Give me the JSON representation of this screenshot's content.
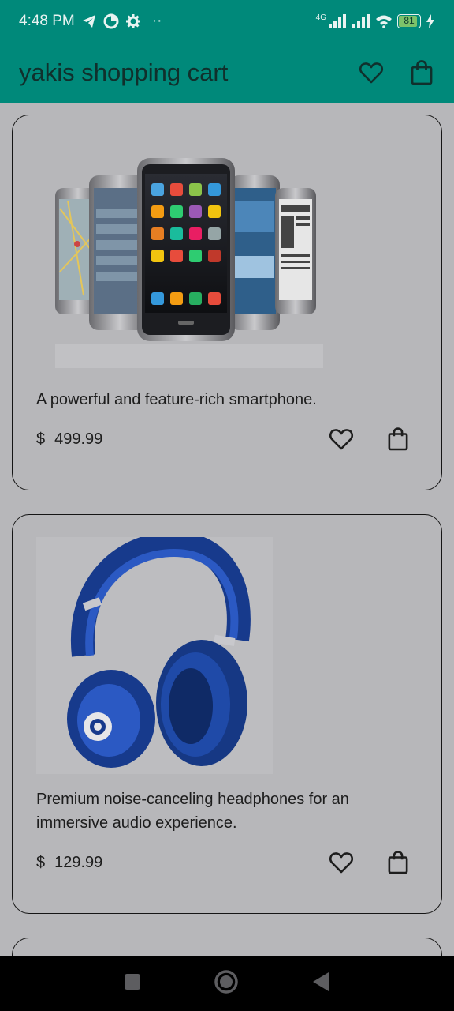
{
  "status_bar": {
    "time": "4:48 PM",
    "dots": "··",
    "network": "4G",
    "battery": "81"
  },
  "app_bar": {
    "title": "yakis shopping cart"
  },
  "products": [
    {
      "description": "A powerful and feature-rich smartphone.",
      "currency": "$",
      "price": "499.99"
    },
    {
      "description": "Premium noise-canceling headphones for an immersive audio experience.",
      "currency": "$",
      "price": "129.99"
    }
  ],
  "colors": {
    "app_bar": "#00897a",
    "background": "#b7b7ba",
    "nav_bar": "#000000"
  },
  "icons": [
    "telegram-icon",
    "data-saver-icon",
    "gear-icon",
    "signal-icon",
    "wifi-icon",
    "battery-icon",
    "heart-icon",
    "shopping-bag-icon",
    "nav-square-icon",
    "nav-home-icon",
    "nav-back-icon"
  ]
}
